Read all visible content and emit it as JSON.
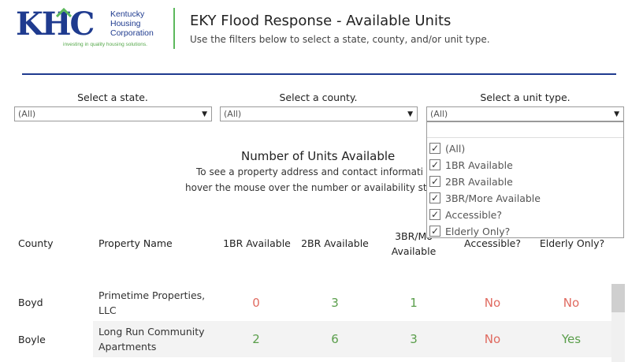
{
  "header": {
    "logo_letters": "KHC",
    "logo_lines": [
      "Kentucky",
      "Housing",
      "Corporation"
    ],
    "logo_tagline": "investing in quality housing solutions.",
    "title": "EKY Flood Response - Available Units",
    "subtitle": "Use the filters below to select a state, county, and/or unit type."
  },
  "filters": [
    {
      "label": "Select a state.",
      "value": "(All)"
    },
    {
      "label": "Select a county.",
      "value": "(All)"
    },
    {
      "label": "Select a unit type.",
      "value": "(All)"
    }
  ],
  "dropdown": {
    "options": [
      {
        "label": "(All)",
        "checked": true
      },
      {
        "label": "1BR Available",
        "checked": true
      },
      {
        "label": "2BR Available",
        "checked": true
      },
      {
        "label": "3BR/More Available",
        "checked": true
      },
      {
        "label": "Accessible?",
        "checked": true
      },
      {
        "label": "Elderly Only?",
        "checked": true
      }
    ]
  },
  "section": {
    "title": "Number of Units Available",
    "note_line1": "To see a property address and contact informati",
    "note_line2": "hover the mouse over the number or availability st"
  },
  "table": {
    "headers": {
      "county": "County",
      "property": "Property Name",
      "br1": "1BR Available",
      "br2": "2BR Available",
      "br3_line1": "3BR/Mo",
      "br3_line2": "Available",
      "accessible": "Accessible?",
      "elderly": "Elderly Only?"
    },
    "rows": [
      {
        "county": "Boyd",
        "property_line1": "Primetime Properties,",
        "property_line2": "LLC",
        "br1": "0",
        "br2": "3",
        "br3": "1",
        "accessible": "No",
        "elderly": "No"
      },
      {
        "county": "Boyle",
        "property_line1": "Long Run Community",
        "property_line2": "Apartments",
        "br1": "2",
        "br2": "6",
        "br3": "3",
        "accessible": "No",
        "elderly": "Yes"
      }
    ]
  },
  "colors": {
    "brand_blue": "#1f3b8f",
    "brand_green": "#5cb85c",
    "value_green": "#5a9e4b",
    "value_red": "#e06a60"
  },
  "icons": [
    "dropdown-arrow-icon",
    "checkbox-checked-icon",
    "house-roof-icon"
  ]
}
